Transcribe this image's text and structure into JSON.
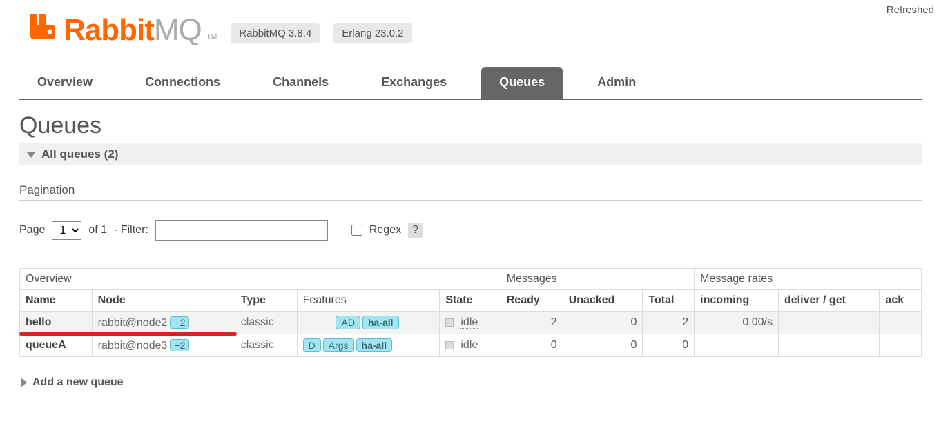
{
  "top": {
    "refreshed": "Refreshed"
  },
  "logo": {
    "rabbit": "Rabbit",
    "mq": "MQ",
    "tm": "TM"
  },
  "versions": {
    "rabbitmq": "RabbitMQ 3.8.4",
    "erlang": "Erlang 23.0.2"
  },
  "tabs": {
    "overview": "Overview",
    "connections": "Connections",
    "channels": "Channels",
    "exchanges": "Exchanges",
    "queues": "Queues",
    "admin": "Admin"
  },
  "page": {
    "title": "Queues",
    "all_queues": "All queues (2)",
    "pagination": "Pagination",
    "page_label": "Page",
    "page_value": "1",
    "of_label": "of 1",
    "filter_label": "- Filter:",
    "regex_label": "Regex",
    "help": "?",
    "add_queue": "Add a new queue"
  },
  "thead": {
    "overview": "Overview",
    "messages": "Messages",
    "rates": "Message rates",
    "name": "Name",
    "node": "Node",
    "type": "Type",
    "features": "Features",
    "state": "State",
    "ready": "Ready",
    "unacked": "Unacked",
    "total": "Total",
    "incoming": "incoming",
    "deliver": "deliver / get",
    "ack": "ack"
  },
  "rows": [
    {
      "name": "hello",
      "node": "rabbit@node2",
      "plus": "+2",
      "type": "classic",
      "features": [
        "AD",
        "ha-all"
      ],
      "feature_bold": [
        false,
        true
      ],
      "state": "idle",
      "ready": "2",
      "unacked": "0",
      "total": "2",
      "incoming": "0.00/s",
      "deliver": "",
      "ack": ""
    },
    {
      "name": "queueA",
      "node": "rabbit@node3",
      "plus": "+2",
      "type": "classic",
      "features": [
        "D",
        "Args",
        "ha-all"
      ],
      "feature_bold": [
        false,
        false,
        true
      ],
      "state": "idle",
      "ready": "0",
      "unacked": "0",
      "total": "0",
      "incoming": "",
      "deliver": "",
      "ack": ""
    }
  ]
}
